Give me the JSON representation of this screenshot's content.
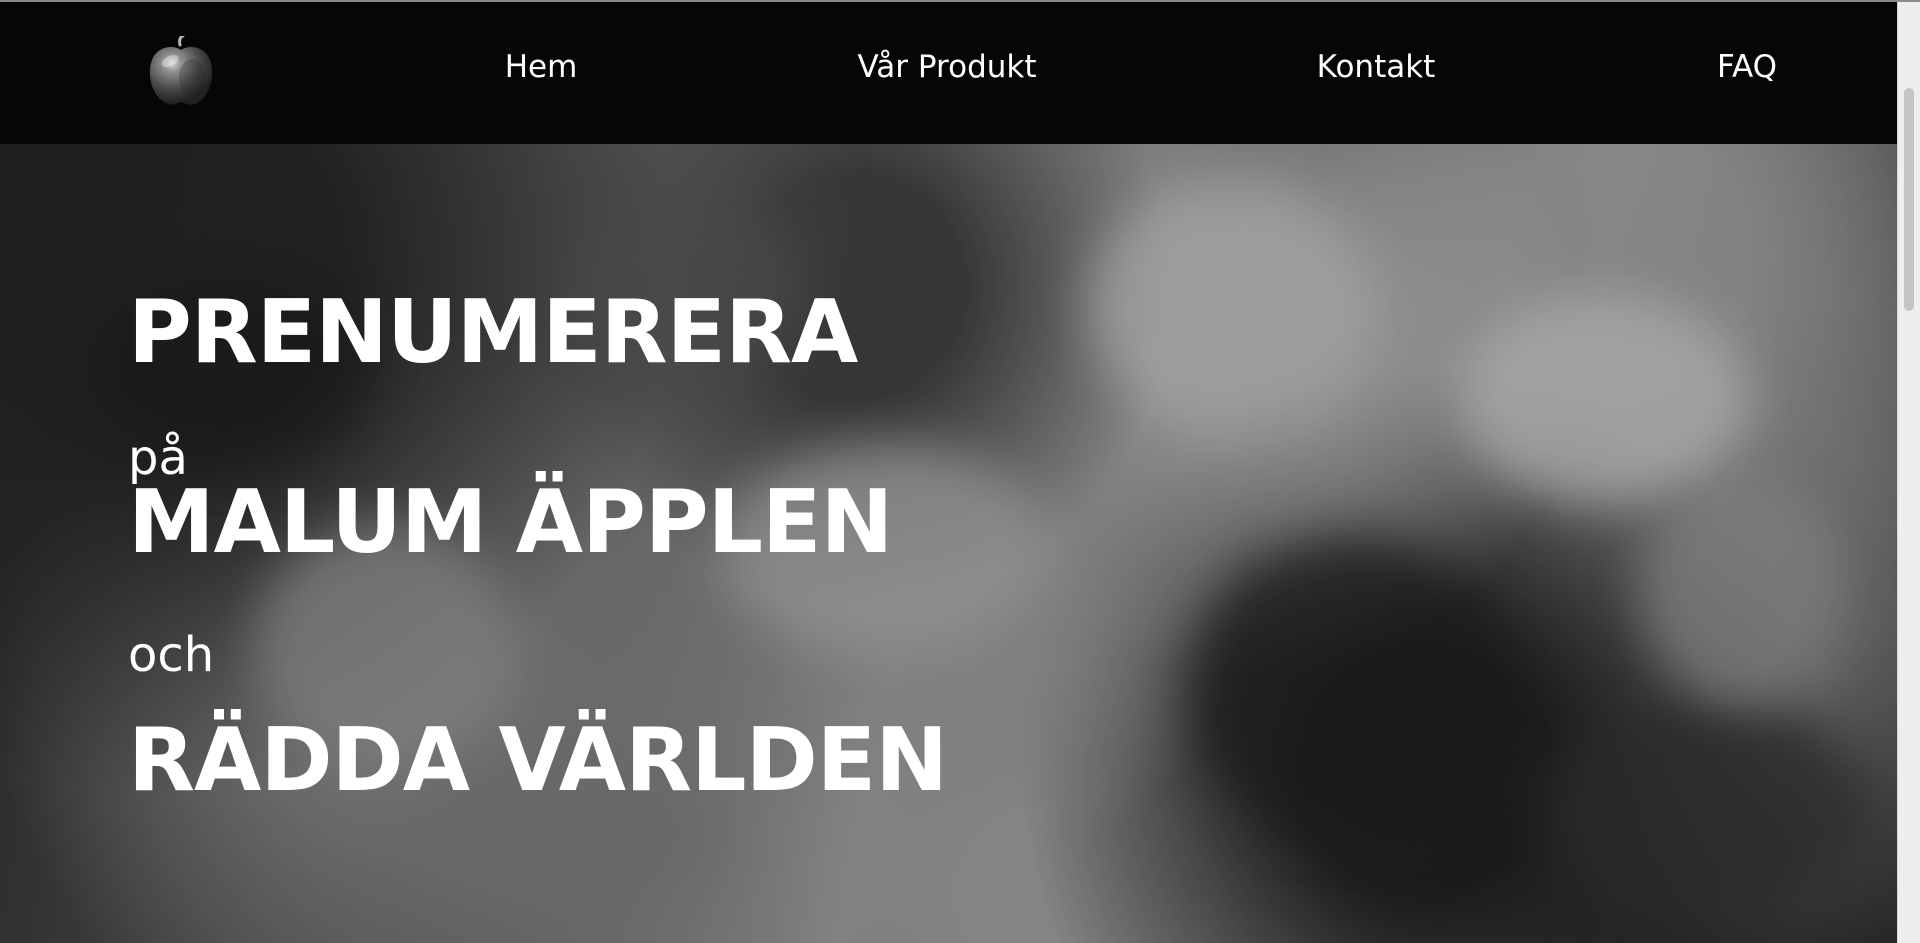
{
  "navigation": {
    "logo_alt": "apple",
    "links": [
      {
        "label": "Hem"
      },
      {
        "label": "Vår Produkt"
      },
      {
        "label": "Kontakt"
      },
      {
        "label": "FAQ"
      }
    ]
  },
  "hero": {
    "line1": "PRENUMERERA",
    "line2": "på",
    "line3": "MALUM ÄPPLEN",
    "line4": "och",
    "line5": "RÄDDA VÄRLDEN"
  },
  "colors": {
    "navbar": "#060606",
    "text": "#ffffff",
    "scrollbar": "#eeeeee",
    "scroll_thumb": "#c5c5c5"
  },
  "icons": {
    "logo": "apple-icon"
  }
}
